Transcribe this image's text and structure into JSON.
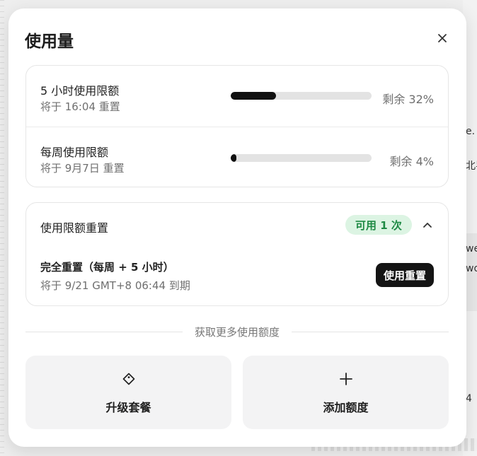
{
  "dialog": {
    "title": "使用量",
    "close_icon": "close-icon"
  },
  "limits": [
    {
      "title": "5 小时使用限额",
      "reset": "将于 16:04 重置",
      "remaining_label": "剩余 32%",
      "used_fraction": 0.32
    },
    {
      "title": "每周使用限额",
      "reset": "将于 9月7日 重置",
      "remaining_label": "剩余 4%",
      "used_fraction": 0.04
    }
  ],
  "reset_section": {
    "title": "使用限额重置",
    "badge": "可用 1 次",
    "collapse_icon": "chevron-up-icon",
    "option_title": "完全重置（每周 + 5 小时）",
    "option_expiry": "将于 9/21 GMT+8 06:44 到期",
    "use_button": "使用重置"
  },
  "more": {
    "divider_label": "获取更多使用额度",
    "upgrade_label": "升级套餐",
    "upgrade_icon": "tag-icon",
    "add_label": "添加额度",
    "add_icon": "plus-icon"
  },
  "background": {
    "right_text": [
      "e.",
      "北导",
      "we",
      "wo",
      "4"
    ]
  },
  "colors": {
    "progress_fill": "#111111",
    "badge_bg": "#dcf4e3",
    "badge_text": "#1e8a44",
    "primary_button": "#141414"
  }
}
